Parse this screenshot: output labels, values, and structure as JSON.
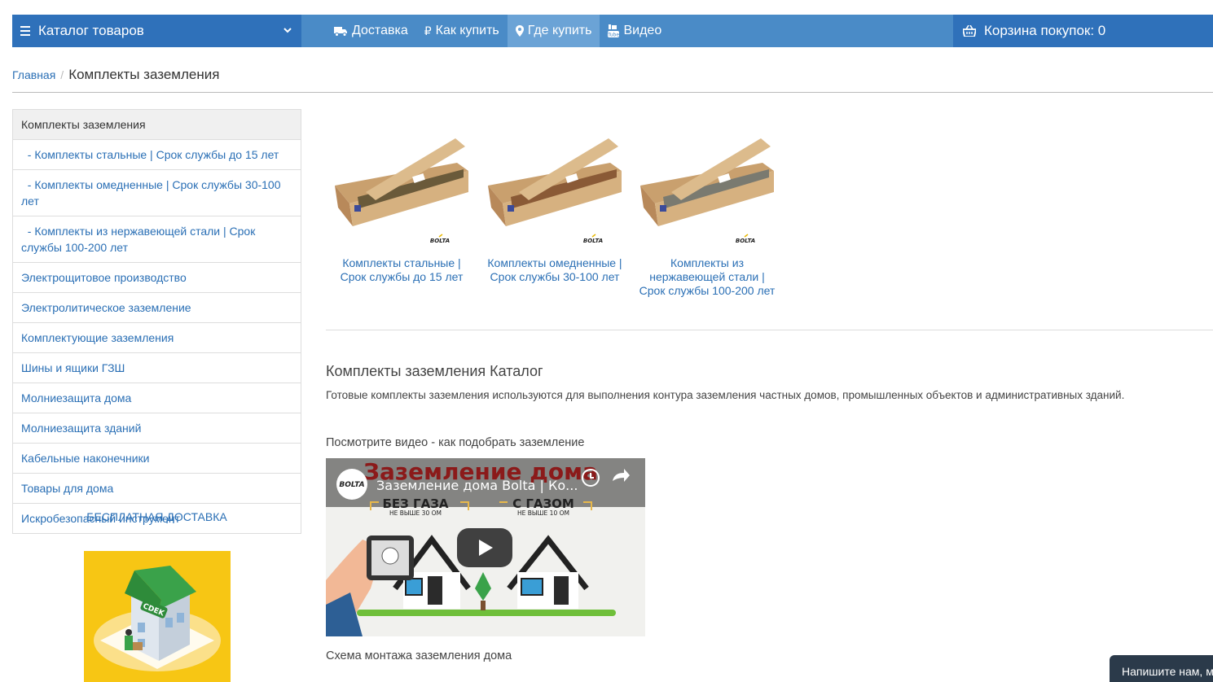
{
  "navbar": {
    "catalog_label": "Каталог товаров",
    "links": [
      {
        "label": "Доставка",
        "icon": "truck-icon"
      },
      {
        "label": "Как купить",
        "icon": "ruble-icon"
      },
      {
        "label": "Где купить",
        "icon": "map-marker-icon"
      },
      {
        "label": "Видео",
        "icon": "youtube-icon"
      }
    ],
    "active_link": "Где купить",
    "cart_label": "Корзина покупок: 0"
  },
  "breadcrumb": {
    "home": "Главная",
    "separator": "/",
    "current": "Комплекты заземления"
  },
  "sidebar": {
    "items": [
      {
        "label": "Комплекты заземления"
      },
      {
        "label": "- Комплекты стальные | Срок службы до 15 лет"
      },
      {
        "label": "- Комплекты омедненные | Срок службы 30-100 лет"
      },
      {
        "label": "- Комплекты из нержавеющей стали | Срок службы 100-200 лет"
      },
      {
        "label": "Электрощитовое производство"
      },
      {
        "label": "Электролитическое заземление"
      },
      {
        "label": "Комплектующие заземления"
      },
      {
        "label": "Шины и ящики ГЗШ"
      },
      {
        "label": "Молниезащита дома"
      },
      {
        "label": "Молниезащита зданий"
      },
      {
        "label": "Кабельные наконечники"
      },
      {
        "label": "Товары для дома"
      },
      {
        "label": "Искробезопасный инструмент"
      }
    ],
    "free_delivery": "БЕСПЛАТНАЯ ДОСТАВКА",
    "cdek_logo": "CDEK"
  },
  "products": [
    {
      "label": "Комплекты стальные | Срок службы до 15 лет",
      "brand": "BOLTA"
    },
    {
      "label": "Комплекты омедненные | Срок службы 30-100 лет",
      "brand": "BOLTA"
    },
    {
      "label": "Комплекты из нержавеющей стали | Срок службы 100-200 лет",
      "brand": "BOLTA"
    }
  ],
  "catalog": {
    "title": "Комплекты заземления Каталог",
    "description": "Готовые комплекты заземления используются для выполнения контура заземления частных домов, промышленных объектов и административных зданий.",
    "video_caption": "Посмотрите видео - как подобрать заземление",
    "scheme_caption": "Схема монтажа заземления дома"
  },
  "video": {
    "title": "Заземление дома Bolta | Ко...",
    "banner": "Заземление дома",
    "left_heading": "БЕЗ ГАЗА",
    "left_sub": "НЕ ВЫШЕ 30 ОМ",
    "right_heading": "С ГАЗОМ",
    "right_sub": "НЕ ВЫШЕ 10 ОМ",
    "channel_logo": "BOLTA"
  },
  "chat": {
    "label": "Напишите нам, м"
  },
  "colors": {
    "nav_dark": "#2f71ba",
    "nav_light": "#4a8bc7",
    "link": "#2a6fb5",
    "cdek_bg": "#f7c614"
  }
}
